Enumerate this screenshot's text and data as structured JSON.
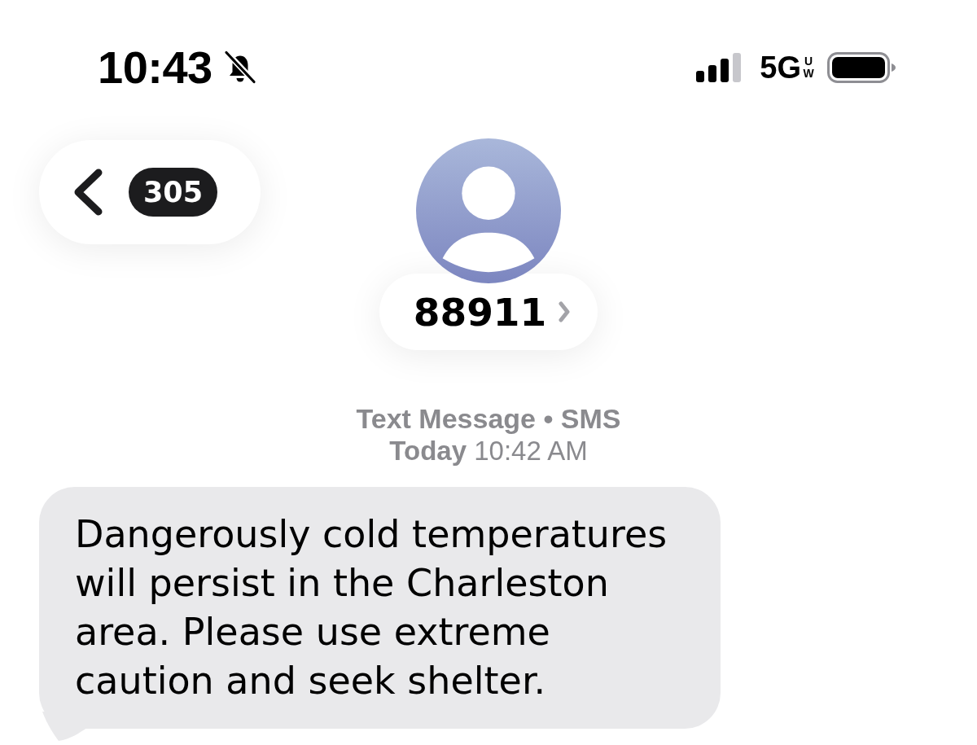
{
  "status_bar": {
    "time": "10:43",
    "silent": true,
    "network": "5G",
    "network_badge": "UW"
  },
  "header": {
    "back_count": "305",
    "contact": "88911"
  },
  "conversation": {
    "service": "Text Message • SMS",
    "timestamp": "**Today** 10:42 AM",
    "messages": [
      {
        "kind": "received",
        "text": "Dangerously cold temperatures will persist in the Charleston area. Please use extreme caution and seek shelter."
      }
    ]
  }
}
